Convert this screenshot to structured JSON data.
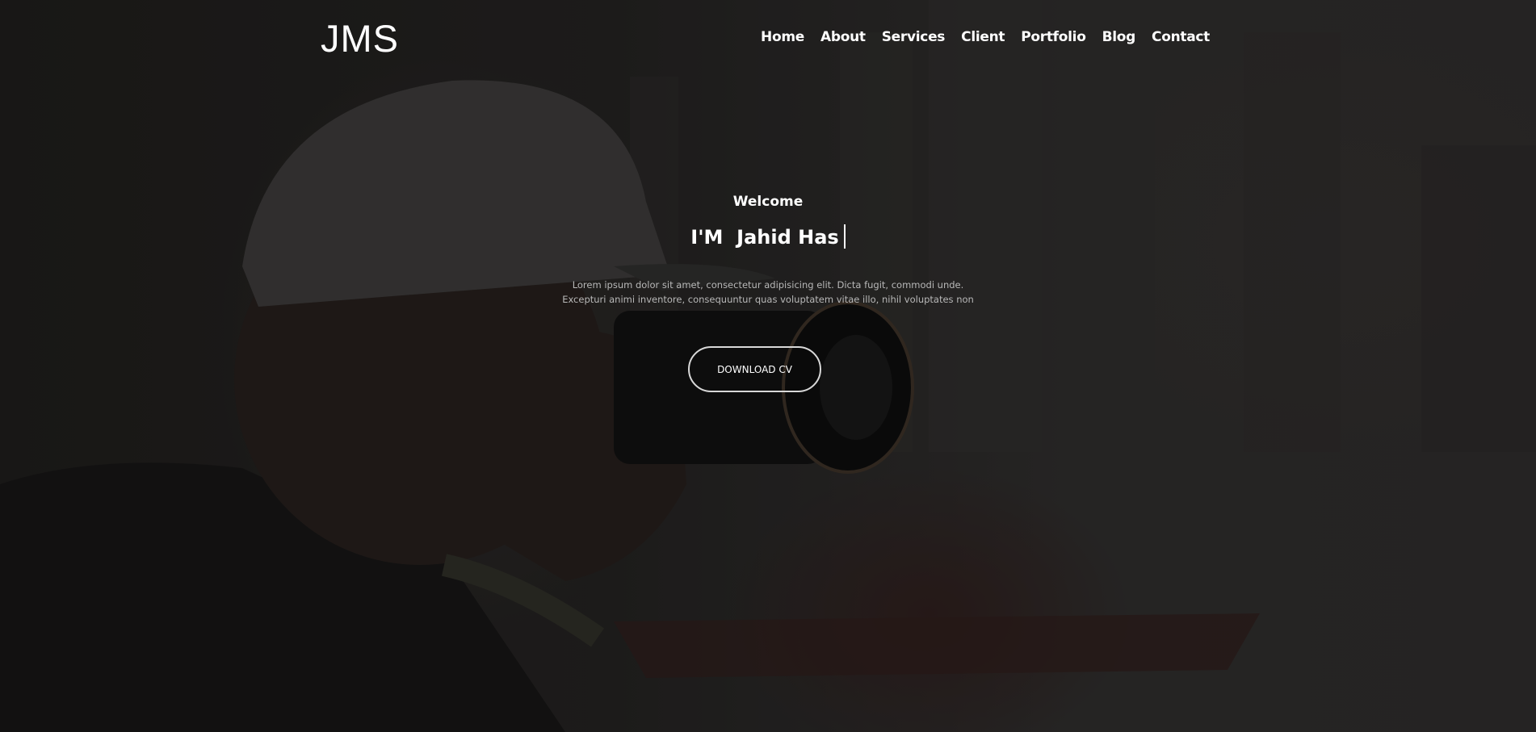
{
  "brand": {
    "logo": "JMS"
  },
  "nav": {
    "items": [
      "Home",
      "About",
      "Services",
      "Client",
      "Portfolio",
      "Blog",
      "Contact"
    ]
  },
  "hero": {
    "welcome": "Welcome",
    "headline": "I'M  Jahid Has",
    "description": "Lorem ipsum dolor sit amet, consectetur adipisicing elit. Dicta fugit, commodi unde. Excepturi animi inventore, consequuntur quas voluptatem vitae illo, nihil voluptates non",
    "button_label": "DOWNLOAD CV",
    "background_image": "photographer-with-camera"
  },
  "colors": {
    "text": "#ffffff",
    "muted_text": "#b8b8b8",
    "overlay": "#1a1a1a"
  }
}
